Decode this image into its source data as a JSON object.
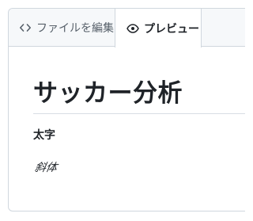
{
  "tabs": {
    "edit": {
      "label": "ファイルを編集",
      "icon": "code-icon",
      "selected": false
    },
    "preview": {
      "label": "プレビュー",
      "icon": "eye-icon",
      "selected": true
    }
  },
  "preview": {
    "heading": "サッカー分析",
    "bold_text": "太字",
    "italic_text": "斜体"
  },
  "colors": {
    "border": "#d0d7de",
    "tab_bar_bg": "#f6f8fa",
    "text": "#1f2328",
    "muted_text": "#57606a"
  }
}
